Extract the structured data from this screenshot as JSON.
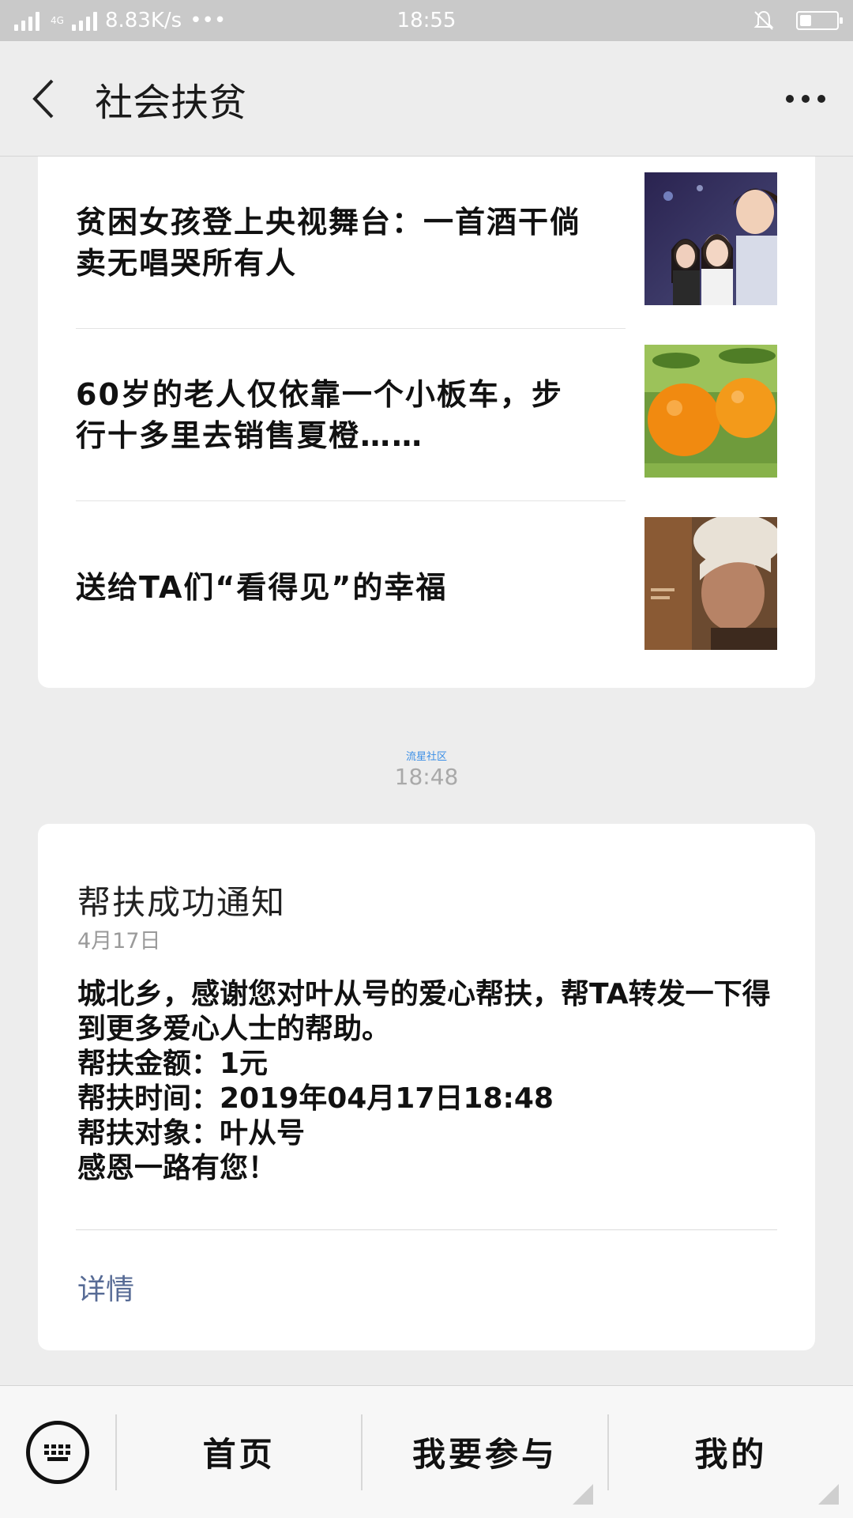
{
  "status_bar": {
    "network_type": "4G",
    "speed": "8.83K/s",
    "dots": "•••",
    "time": "18:55"
  },
  "header": {
    "title": "社会扶贫"
  },
  "articles": [
    {
      "title": "贫困女孩登上央视舞台：一首酒干倘卖无唱哭所有人",
      "thumb_icon": "photo-girls-stage"
    },
    {
      "title": "60岁的老人仅依靠一个小板车，步行十多里去销售夏橙……",
      "thumb_icon": "photo-oranges"
    },
    {
      "title": "送给TA们“看得见”的幸福",
      "thumb_icon": "photo-elderly-woman"
    }
  ],
  "timestamp": {
    "tag": "流星社区",
    "time": "18:48"
  },
  "notice": {
    "title": "帮扶成功通知",
    "date": "4月17日",
    "lines": [
      "城北乡，感谢您对叶从号的爱心帮扶，帮TA转发一下得到更多爱心人士的帮助。",
      "帮扶金额：1元",
      "帮扶时间：2019年04月17日18:48",
      "帮扶对象：叶从号",
      "感恩一路有您！"
    ],
    "detail_label": "详情"
  },
  "bottom_menu": {
    "items": [
      "首页",
      "我要参与",
      "我的"
    ]
  },
  "colors": {
    "background": "#ededed",
    "link": "#576b95",
    "timestamp_tag": "#3a8ee6"
  }
}
